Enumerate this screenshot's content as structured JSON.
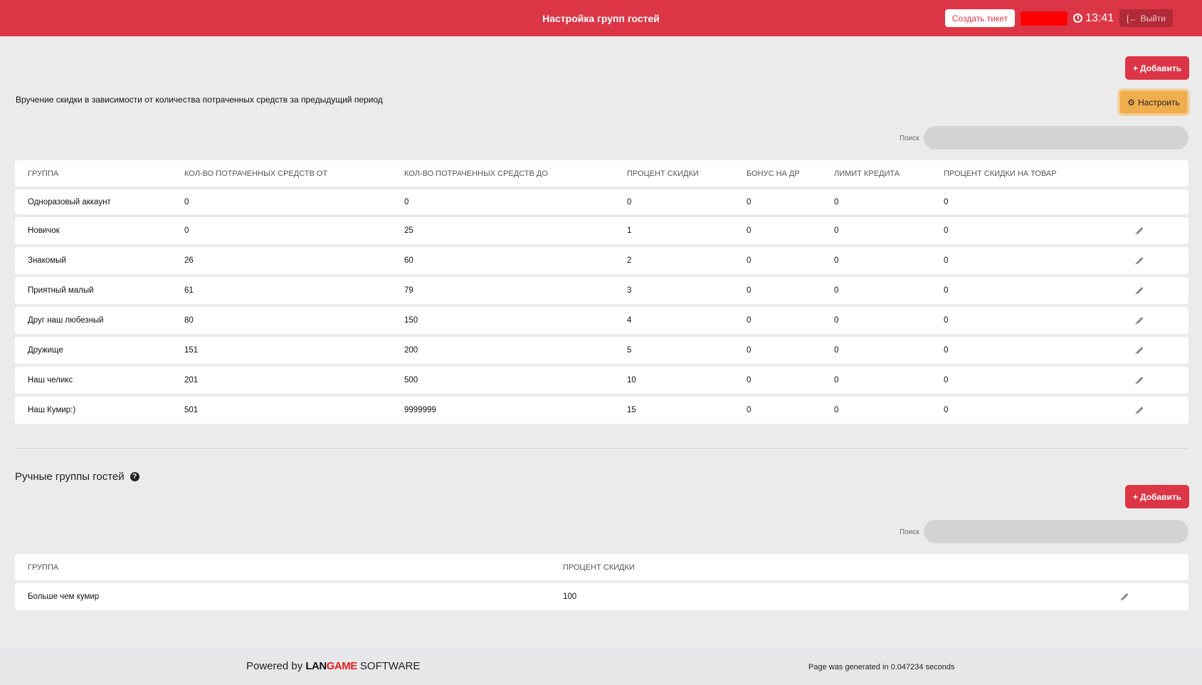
{
  "header": {
    "title": "Настройка групп гостей",
    "ticket_label": "Создать тикет",
    "time": "13:41",
    "exit_label": "Выйти",
    "exit_icon": "sign-out-icon",
    "clock_icon": "clock-icon"
  },
  "auto_groups": {
    "add_label": "Добавить",
    "config_label": "Настроить",
    "description": "Вручение скидки в зависимости от количества потраченных средств за предыдущий период",
    "search_label": "Поиск",
    "columns": [
      "ГРУППА",
      "КОЛ-ВО ПОТРАЧЕННЫХ СРЕДСТВ ОТ",
      "КОЛ-ВО ПОТРАЧЕННЫХ СРЕДСТВ ДО",
      "ПРОЦЕНТ СКИДКИ",
      "БОНУС НА ДР",
      "ЛИМИТ КРЕДИТА",
      "ПРОЦЕНТ СКИДКИ НА ТОВАР"
    ],
    "rows": [
      {
        "group": "Одноразовый аккаунт",
        "from": "0",
        "to": "0",
        "discount": "0",
        "bonus": "0",
        "credit": "0",
        "goods": "0",
        "editable": false
      },
      {
        "group": "Новичок",
        "from": "0",
        "to": "25",
        "discount": "1",
        "bonus": "0",
        "credit": "0",
        "goods": "0",
        "editable": true
      },
      {
        "group": "Знакомый",
        "from": "26",
        "to": "60",
        "discount": "2",
        "bonus": "0",
        "credit": "0",
        "goods": "0",
        "editable": true
      },
      {
        "group": "Приятный малый",
        "from": "61",
        "to": "79",
        "discount": "3",
        "bonus": "0",
        "credit": "0",
        "goods": "0",
        "editable": true
      },
      {
        "group": "Друг наш любезный",
        "from": "80",
        "to": "150",
        "discount": "4",
        "bonus": "0",
        "credit": "0",
        "goods": "0",
        "editable": true
      },
      {
        "group": "Дружище",
        "from": "151",
        "to": "200",
        "discount": "5",
        "bonus": "0",
        "credit": "0",
        "goods": "0",
        "editable": true
      },
      {
        "group": "Наш челикс",
        "from": "201",
        "to": "500",
        "discount": "10",
        "bonus": "0",
        "credit": "0",
        "goods": "0",
        "editable": true
      },
      {
        "group": "Наш Кумир:)",
        "from": "501",
        "to": "9999999",
        "discount": "15",
        "bonus": "0",
        "credit": "0",
        "goods": "0",
        "editable": true
      }
    ]
  },
  "manual_groups": {
    "title": "Ручные группы гостей",
    "help_icon": "question-circle-icon",
    "add_label": "Добавить",
    "search_label": "Поиск",
    "columns": [
      "ГРУППА",
      "ПРОЦЕНТ СКИДКИ"
    ],
    "rows": [
      {
        "group": "Больше чем кумир",
        "discount": "100",
        "editable": true
      }
    ]
  },
  "footer": {
    "powered_by": "Powered by",
    "brand_lan": "LAN",
    "brand_game": "GAME",
    "brand_software": "SOFTWARE",
    "generated": "Page was generated in 0.047234 seconds"
  },
  "colors": {
    "primary": "#dc3545",
    "warning": "#f0ad4e",
    "background": "#ebebeb"
  }
}
